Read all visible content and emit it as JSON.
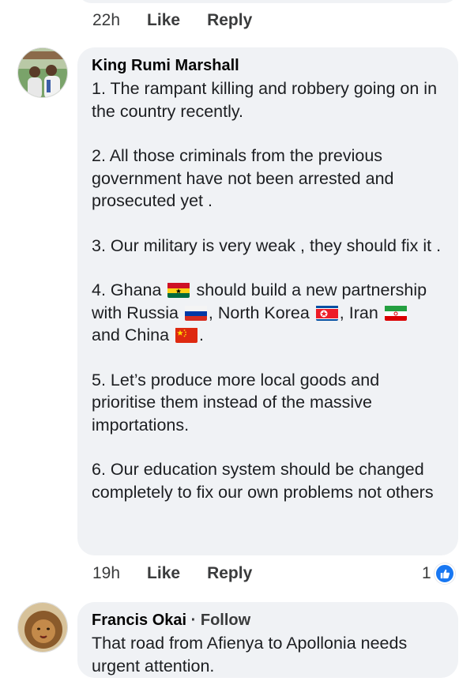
{
  "previous_comment": {
    "time": "22h",
    "like_label": "Like",
    "reply_label": "Reply"
  },
  "comment1": {
    "author": "King Rumi Marshall",
    "paragraphs": {
      "p1": "1. The rampant killing and robbery going on in the country recently.",
      "p2": "2. All those criminals from the previous government have not been arrested and prosecuted yet .",
      "p3": "3. Our military is very weak , they should fix it .",
      "p4_a": "4. Ghana",
      "p4_b": "should build a new partnership with Russia",
      "p4_c": ", North Korea",
      "p4_d": ", Iran",
      "p4_e": "and China",
      "p4_f": ".",
      "p5": "5. Let’s produce more local goods and prioritise them instead of the massive importations.",
      "p6": "6. Our education system should be changed completely to fix our own problems not others"
    },
    "time": "19h",
    "like_label": "Like",
    "reply_label": "Reply",
    "reaction_count": "1",
    "reaction_icon": "thumbs-up-icon",
    "accent": "#1877f2"
  },
  "comment2": {
    "author": "Francis Okai",
    "separator": "·",
    "follow_label": "Follow",
    "text": "That road from Afienya to Apollonia needs urgent attention."
  },
  "colors": {
    "bubble": "#f0f2f5",
    "meta_text": "#3a3b3c"
  }
}
